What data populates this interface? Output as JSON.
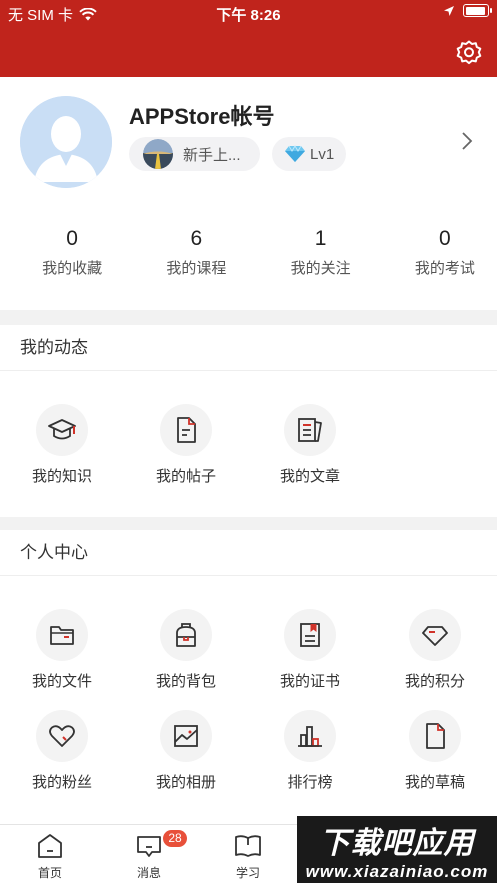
{
  "status_bar": {
    "carrier": "无 SIM 卡",
    "time": "下午 8:26",
    "battery_level": 0.95
  },
  "profile": {
    "username": "APPStore帐号",
    "level_badge": "新手上...",
    "lv_badge": "Lv1",
    "stats": [
      {
        "value": "0",
        "label": "我的收藏"
      },
      {
        "value": "6",
        "label": "我的课程"
      },
      {
        "value": "1",
        "label": "我的关注"
      },
      {
        "value": "0",
        "label": "我的考试"
      }
    ]
  },
  "dynamics": {
    "title": "我的动态",
    "items": [
      {
        "label": "我的知识",
        "icon": "graduation-cap-icon"
      },
      {
        "label": "我的帖子",
        "icon": "post-document-icon"
      },
      {
        "label": "我的文章",
        "icon": "article-icon"
      }
    ]
  },
  "personal_center": {
    "title": "个人中心",
    "items": [
      {
        "label": "我的文件",
        "icon": "folder-icon"
      },
      {
        "label": "我的背包",
        "icon": "backpack-icon"
      },
      {
        "label": "我的证书",
        "icon": "certificate-icon"
      },
      {
        "label": "我的积分",
        "icon": "diamond-icon"
      },
      {
        "label": "我的粉丝",
        "icon": "heart-icon"
      },
      {
        "label": "我的相册",
        "icon": "photo-album-icon"
      },
      {
        "label": "排行榜",
        "icon": "ranking-chart-icon"
      },
      {
        "label": "我的草稿",
        "icon": "draft-document-icon"
      }
    ]
  },
  "tabbar": {
    "tabs": [
      {
        "label": "首页",
        "icon": "home-icon"
      },
      {
        "label": "消息",
        "icon": "message-icon",
        "badge": "28"
      },
      {
        "label": "学习",
        "icon": "book-icon"
      }
    ]
  },
  "watermark": {
    "line1": "下载吧应用",
    "line2": "www.xiazainiao.com"
  },
  "colors": {
    "brand": "#c0241c",
    "accent_red": "#d0332a",
    "badge": "#e8503a"
  }
}
